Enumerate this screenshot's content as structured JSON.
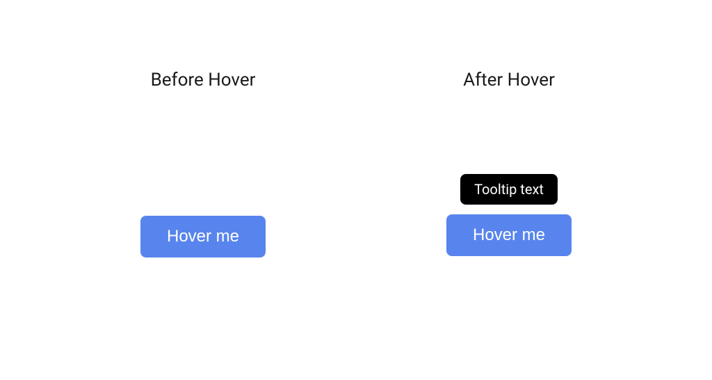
{
  "left": {
    "heading": "Before Hover",
    "button_label": "Hover me"
  },
  "right": {
    "heading": "After Hover",
    "tooltip_text": "Tooltip text",
    "button_label": "Hover me"
  }
}
